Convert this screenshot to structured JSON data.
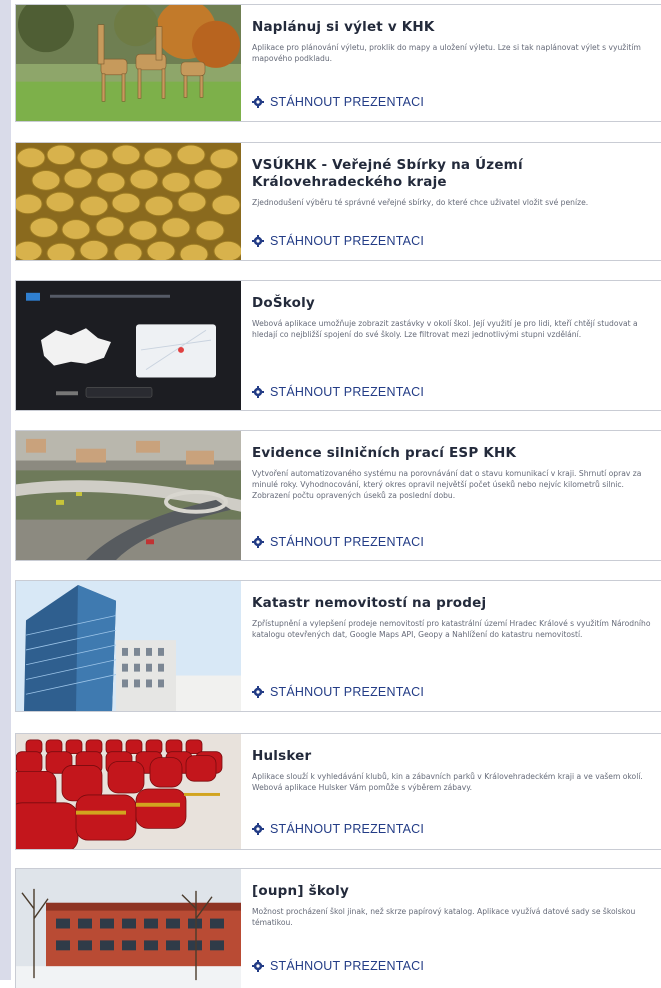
{
  "download_label": "STÁHNOUT PREZENTACI",
  "colors": {
    "accent": "#233c86",
    "title": "#232a3b",
    "text": "#656a78",
    "border": "#c9ccd4",
    "sidebar": "#d9dbe9"
  },
  "projects": [
    {
      "title": "Naplánuj si výlet v KHK",
      "description": "Aplikace pro plánování výletu, proklik do mapy a uložení výletu. Lze si tak naplánovat výlet s využitím mapového podkladu.",
      "image": "giraffes-zoo-photo"
    },
    {
      "title": "VSÚKHK - Veřejné Sbírky na Území Královehradeckého kraje",
      "description": "Zjednodušení výběru té správné veřejné sbírky, do které chce uživatel vložit své peníze.",
      "image": "coins-photo"
    },
    {
      "title": "DoŠkoly",
      "description": "Webová aplikace umožňuje zobrazit zastávky v okolí škol. Její využití je pro lidi, kteří chtějí studovat a hledají co nejbližší spojení do své školy. Lze filtrovat mezi jednotlivými stupni vzdělání.",
      "image": "app-screenshot-czech-map"
    },
    {
      "title": "Evidence silničních prací ESP KHK",
      "description": "Vytvoření automatizovaného systému na porovnávání dat o stavu komunikací v kraji. Shrnutí oprav za minulé roky. Vyhodnocování, který okres opravil největší počet úseků nebo nejvíc kilometrů silnic. Zobrazení počtu opravených úseků za poslední dobu.",
      "image": "road-bridge-aerial-photo"
    },
    {
      "title": "Katastr nemovitostí na prodej",
      "description": "Zpřístupnění a vylepšení prodeje nemovitostí pro katastrální území Hradec Králové s využitím Národního katalogu otevřených dat, Google Maps API, Geopy a Nahlížení do katastru nemovitostí.",
      "image": "office-building-photo"
    },
    {
      "title": "Hulsker",
      "description": "Aplikace slouží k vyhledávání klubů, kin a zábavních parků v Královehradeckém kraji a ve vašem okolí. Webová aplikace Hulsker Vám pomůže s výběrem zábavy.",
      "image": "red-cinema-seats-photo"
    },
    {
      "title": "[oupn] školy",
      "description": "Možnost procházení škol jinak, než skrze papírový katalog. Aplikace využívá datové sady se školskou tématikou.",
      "image": "school-building-photo"
    }
  ]
}
